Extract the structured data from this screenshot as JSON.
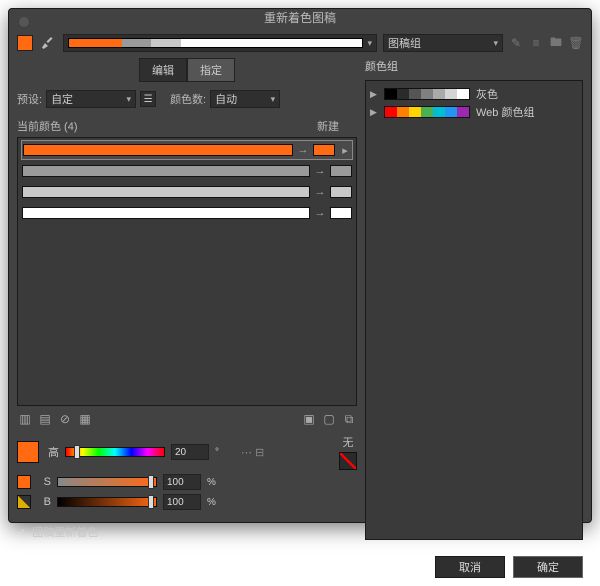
{
  "title": "重新着色图稿",
  "top": {
    "group_dropdown": "图稿组"
  },
  "tabs": {
    "edit": "编辑",
    "assign": "指定"
  },
  "preset": {
    "label": "预设:",
    "value": "自定",
    "countLabel": "颜色数:",
    "countValue": "自动"
  },
  "rows": {
    "currentLabel": "当前颜色 (4)",
    "newLabel": "新建",
    "items": [
      {
        "bar": "#ff6a13",
        "swatch": "#ff6a13"
      },
      {
        "bar": "#9a9a9a",
        "swatch": "#9a9a9a"
      },
      {
        "bar": "#c8c8c8",
        "swatch": "#c8c8c8"
      },
      {
        "bar": "#ffffff",
        "swatch": "#ffffff"
      }
    ]
  },
  "noneLabel": "无",
  "hsb": {
    "hLabel": "高",
    "sLabel": "S",
    "bLabel": "B",
    "h": "20",
    "s": "100",
    "b": "100",
    "degUnit": "°",
    "pctUnit": "%"
  },
  "checkbox": "图稿重新着色",
  "groups": {
    "header": "颜色组",
    "items": [
      {
        "name": "灰色",
        "colors": [
          "#000000",
          "#2b2b2b",
          "#555555",
          "#808080",
          "#aaaaaa",
          "#d4d4d4",
          "#ffffff"
        ]
      },
      {
        "name": "Web 颜色组",
        "colors": [
          "#ff0000",
          "#ff7f00",
          "#ffd400",
          "#4caf50",
          "#00bcd4",
          "#2196f3",
          "#9c27b0"
        ]
      }
    ]
  },
  "buttons": {
    "cancel": "取消",
    "ok": "确定"
  }
}
